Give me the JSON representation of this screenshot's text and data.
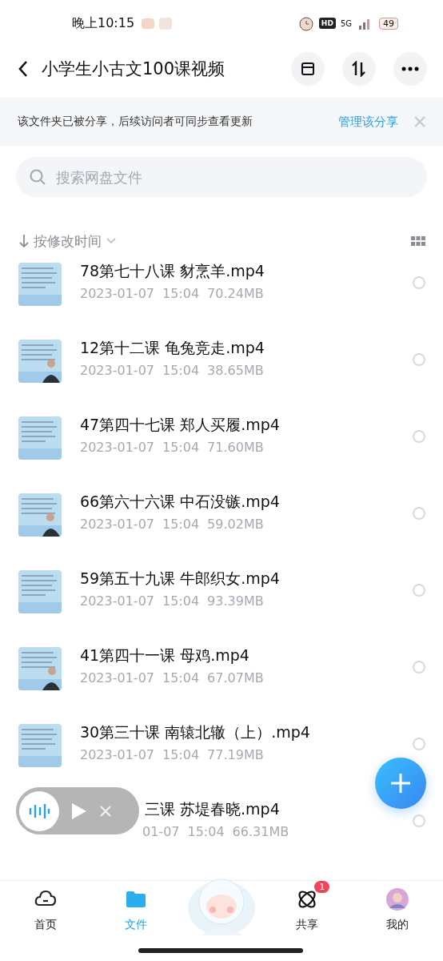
{
  "status_bar": {
    "time": "晚上10:15",
    "network": "5G",
    "hd": "HD",
    "battery": "49"
  },
  "header": {
    "title": "小学生小古文100课视频"
  },
  "share_banner": {
    "text": "该文件夹已被分享，后续访问者可同步查看更新",
    "link": "管理该分享"
  },
  "search": {
    "placeholder": "搜索网盘文件"
  },
  "sort": {
    "label": "按修改时间"
  },
  "files": [
    {
      "kind": "file",
      "title": "78第七十八课 豺烹羊.mp4",
      "date": "2023-01-07",
      "time": "15:04",
      "size": "70.24MB",
      "selected": false
    },
    {
      "kind": "file",
      "title": "12第十二课 龟兔竞走.mp4",
      "date": "2023-01-07",
      "time": "15:04",
      "size": "38.65MB",
      "selected": false
    },
    {
      "kind": "file",
      "title": "47第四十七课 郑人买履.mp4",
      "date": "2023-01-07",
      "time": "15:04",
      "size": "71.60MB",
      "selected": false
    },
    {
      "kind": "file",
      "title": "66第六十六课 中石没镞.mp4",
      "date": "2023-01-07",
      "time": "15:04",
      "size": "59.02MB",
      "selected": false
    },
    {
      "kind": "file",
      "title": "59第五十九课 牛郎织女.mp4",
      "date": "2023-01-07",
      "time": "15:04",
      "size": "93.39MB",
      "selected": false
    },
    {
      "kind": "file",
      "title": "41第四十一课 母鸡.mp4",
      "date": "2023-01-07",
      "time": "15:04",
      "size": "67.07MB",
      "selected": false
    },
    {
      "kind": "file",
      "title": "30第三十课 南辕北辙（上）.mp4",
      "date": "2023-01-07",
      "time": "15:04",
      "size": "77.19MB",
      "selected": false
    },
    {
      "kind": "covered",
      "title": "三课 苏堤春晓.mp4",
      "date": "01-07",
      "time": "15:04",
      "size": "66.31MB",
      "selected": false
    }
  ],
  "tabs": [
    {
      "kind": "tab",
      "label": "首页",
      "selected": false
    },
    {
      "kind": "tab",
      "label": "文件",
      "selected": true
    },
    {
      "kind": "mascot"
    },
    {
      "kind": "tab",
      "label": "共享",
      "selected": false,
      "badge": "1"
    },
    {
      "kind": "tab",
      "label": "我的",
      "selected": false
    }
  ]
}
